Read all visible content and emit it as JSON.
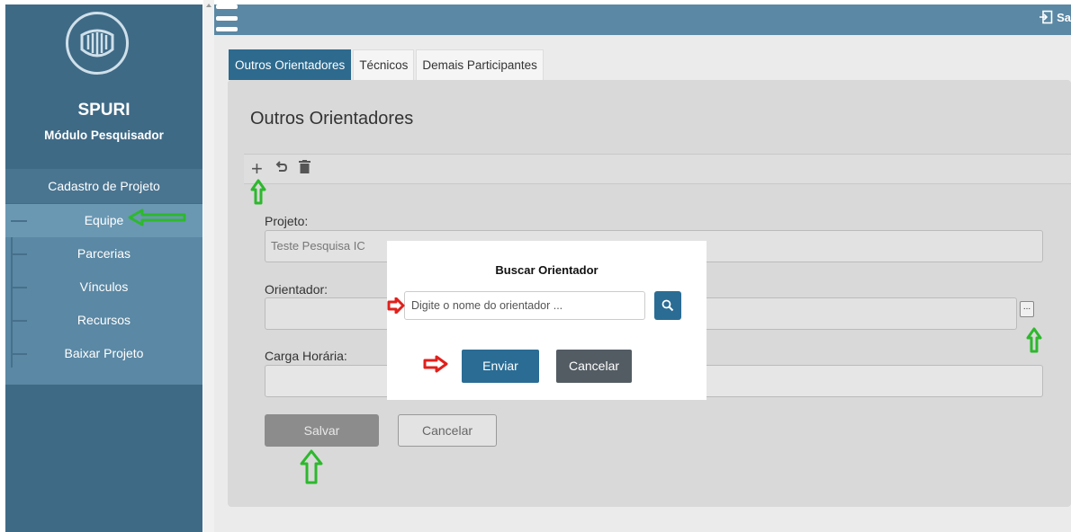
{
  "sidebar": {
    "app_name": "SPURI",
    "module": "Módulo Pesquisador",
    "menu_head": "Cadastro de Projeto",
    "items": [
      {
        "label": "Equipe"
      },
      {
        "label": "Parcerias"
      },
      {
        "label": "Vínculos"
      },
      {
        "label": "Recursos"
      },
      {
        "label": "Baixar Projeto"
      }
    ]
  },
  "topbar": {
    "right_label": "Sa"
  },
  "tabs": [
    "Outros Orientadores",
    "Técnicos",
    "Demais Participantes"
  ],
  "panel": {
    "title": "Outros Orientadores",
    "projeto_label": "Projeto:",
    "projeto_value": "Teste Pesquisa IC",
    "orientador_label": "Orientador:",
    "ellipsis": "...",
    "carga_label": "Carga Horária:",
    "save": "Salvar",
    "cancel": "Cancelar"
  },
  "modal": {
    "title": "Buscar Orientador",
    "placeholder": "Digite o nome do orientador ...",
    "send": "Enviar",
    "cancel": "Cancelar"
  },
  "colors": {
    "green_arrow": "#2db82d",
    "red_arrow": "#e0201c",
    "primary": "#2a6c94"
  },
  "icons": [
    "plus-icon",
    "undo-icon",
    "trash-icon",
    "search-icon",
    "logout-icon",
    "menu-icon"
  ]
}
